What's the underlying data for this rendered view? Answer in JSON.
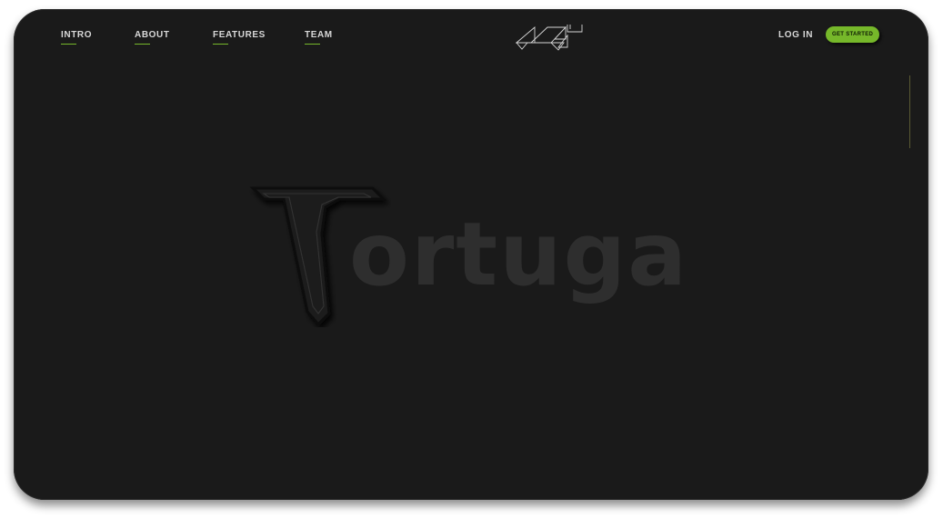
{
  "nav": {
    "items": [
      {
        "label": "INTRO"
      },
      {
        "label": "ABOUT"
      },
      {
        "label": "FEATURES"
      },
      {
        "label": "TEAM"
      }
    ],
    "login_label": "LOG IN",
    "cta_label": "GET STARTED"
  },
  "hero": {
    "wordmark_rest": "ortuga"
  },
  "icons": {
    "brand": "abstract-geometric-logo-icon",
    "hero_letter": "outlined-t-letter-icon"
  },
  "colors": {
    "background": "#1a1a1a",
    "accent": "#76b82a",
    "nav_text": "#d8d8d8",
    "wordmark": "#2e2e2e"
  }
}
